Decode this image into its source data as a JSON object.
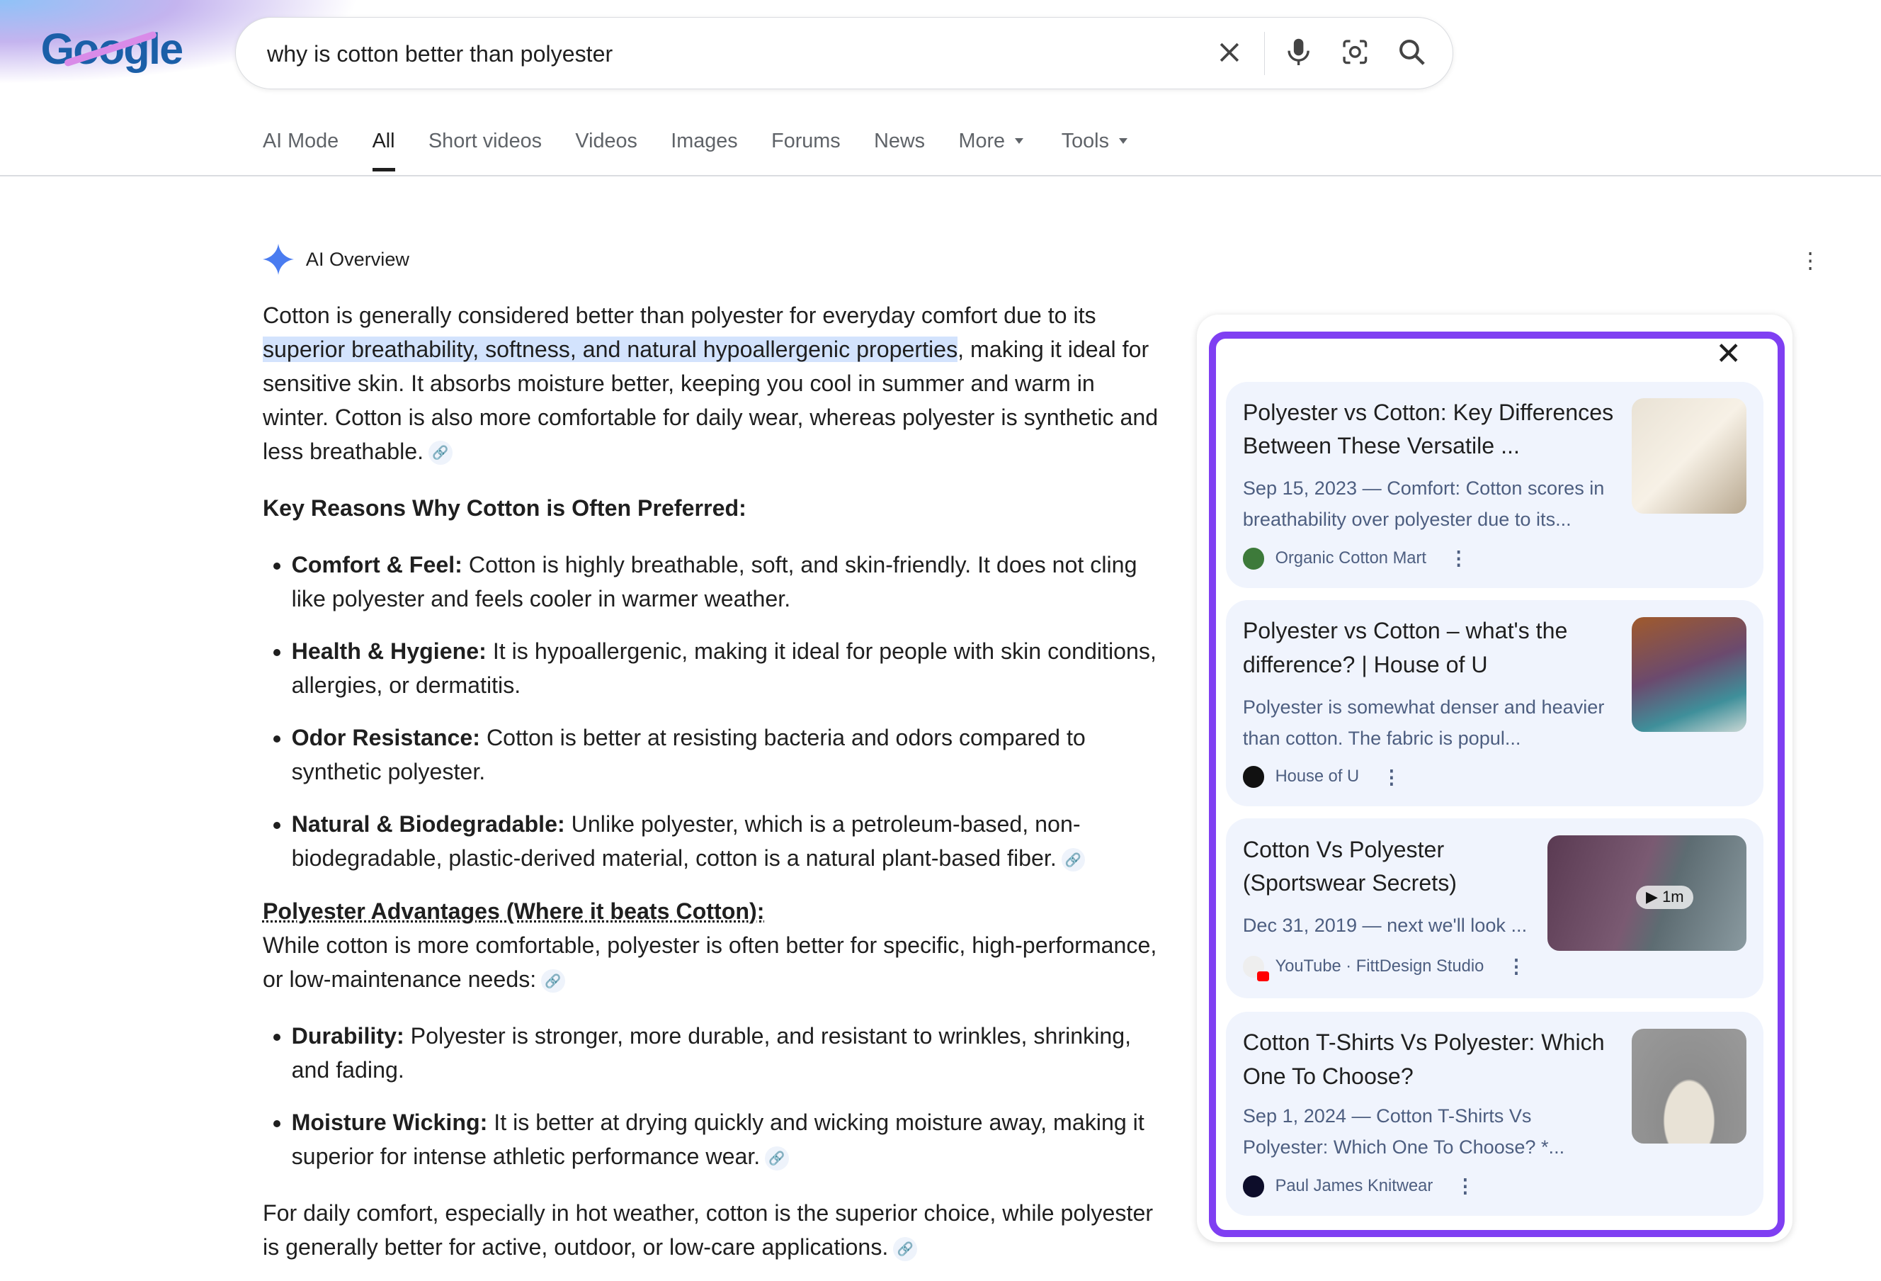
{
  "logo": "Google",
  "search": {
    "query": "why is cotton better than polyester"
  },
  "tabs": [
    {
      "label": "AI Mode"
    },
    {
      "label": "All"
    },
    {
      "label": "Short videos"
    },
    {
      "label": "Videos"
    },
    {
      "label": "Images"
    },
    {
      "label": "Forums"
    },
    {
      "label": "News"
    },
    {
      "label": "More"
    },
    {
      "label": "Tools"
    }
  ],
  "ai_overview": {
    "title": "AI Overview",
    "intro_a": "Cotton is generally considered better than polyester for everyday comfort due to its ",
    "intro_hl": "superior breathability, softness, and natural hypoallergenic properties",
    "intro_b": ", making it ideal for sensitive skin. It absorbs moisture better, keeping you cool in summer and warm in winter. Cotton is also more comfortable for daily wear, whereas polyester is synthetic and less breathable.",
    "heading1": "Key Reasons Why Cotton is Often Preferred:",
    "reasons": [
      {
        "term": "Comfort & Feel:",
        "text": " Cotton is highly breathable, soft, and skin-friendly. It does not cling like polyester and feels cooler in warmer weather."
      },
      {
        "term": "Health & Hygiene:",
        "text": " It is hypoallergenic, making it ideal for people with skin conditions, allergies, or dermatitis."
      },
      {
        "term": "Odor Resistance:",
        "text": " Cotton is better at resisting bacteria and odors compared to synthetic polyester."
      },
      {
        "term": "Natural & Biodegradable:",
        "text": " Unlike polyester, which is a petroleum-based, non-biodegradable, plastic-derived material, cotton is a natural plant-based fiber."
      }
    ],
    "heading2": "Polyester Advantages (Where it beats Cotton):",
    "para2": "While cotton is more comfortable, polyester is often better for specific, high-performance, or low-maintenance needs:",
    "advantages": [
      {
        "term": "Durability:",
        "text": " Polyester is stronger, more durable, and resistant to wrinkles, shrinking, and fading."
      },
      {
        "term": "Moisture Wicking:",
        "text": " It is better at drying quickly and wicking moisture away, making it superior for intense athletic performance wear."
      }
    ],
    "conclusion": "For daily comfort, especially in hot weather, cotton is the superior choice, while polyester is generally better for active, outdoor, or low-care applications."
  },
  "sources": [
    {
      "title": "Polyester vs Cotton: Key Differences Between These Versatile ...",
      "snippet": "Sep 15, 2023 — Comfort: Cotton scores in breathability over polyester due to its...",
      "source": "Organic Cotton Mart"
    },
    {
      "title": "Polyester vs Cotton – what's the difference? | House of U",
      "snippet": "Polyester is somewhat denser and heavier than cotton. The fabric is popul...",
      "source": "House of U"
    },
    {
      "title": "Cotton Vs Polyester (Sportswear Secrets)",
      "snippet": "Dec 31, 2019 — next we'll look ...",
      "source": "YouTube · FittDesign Studio",
      "duration": "1m"
    },
    {
      "title": "Cotton T-Shirts Vs Polyester: Which One To Choose?",
      "snippet": "Sep 1, 2024 — Cotton T-Shirts Vs Polyester: Which One To Choose? *...",
      "source": "Paul James Knitwear"
    }
  ],
  "colors": {
    "accent": "#7f3ff2",
    "highlight": "#d3e3fd",
    "card": "#f0f4fd"
  }
}
